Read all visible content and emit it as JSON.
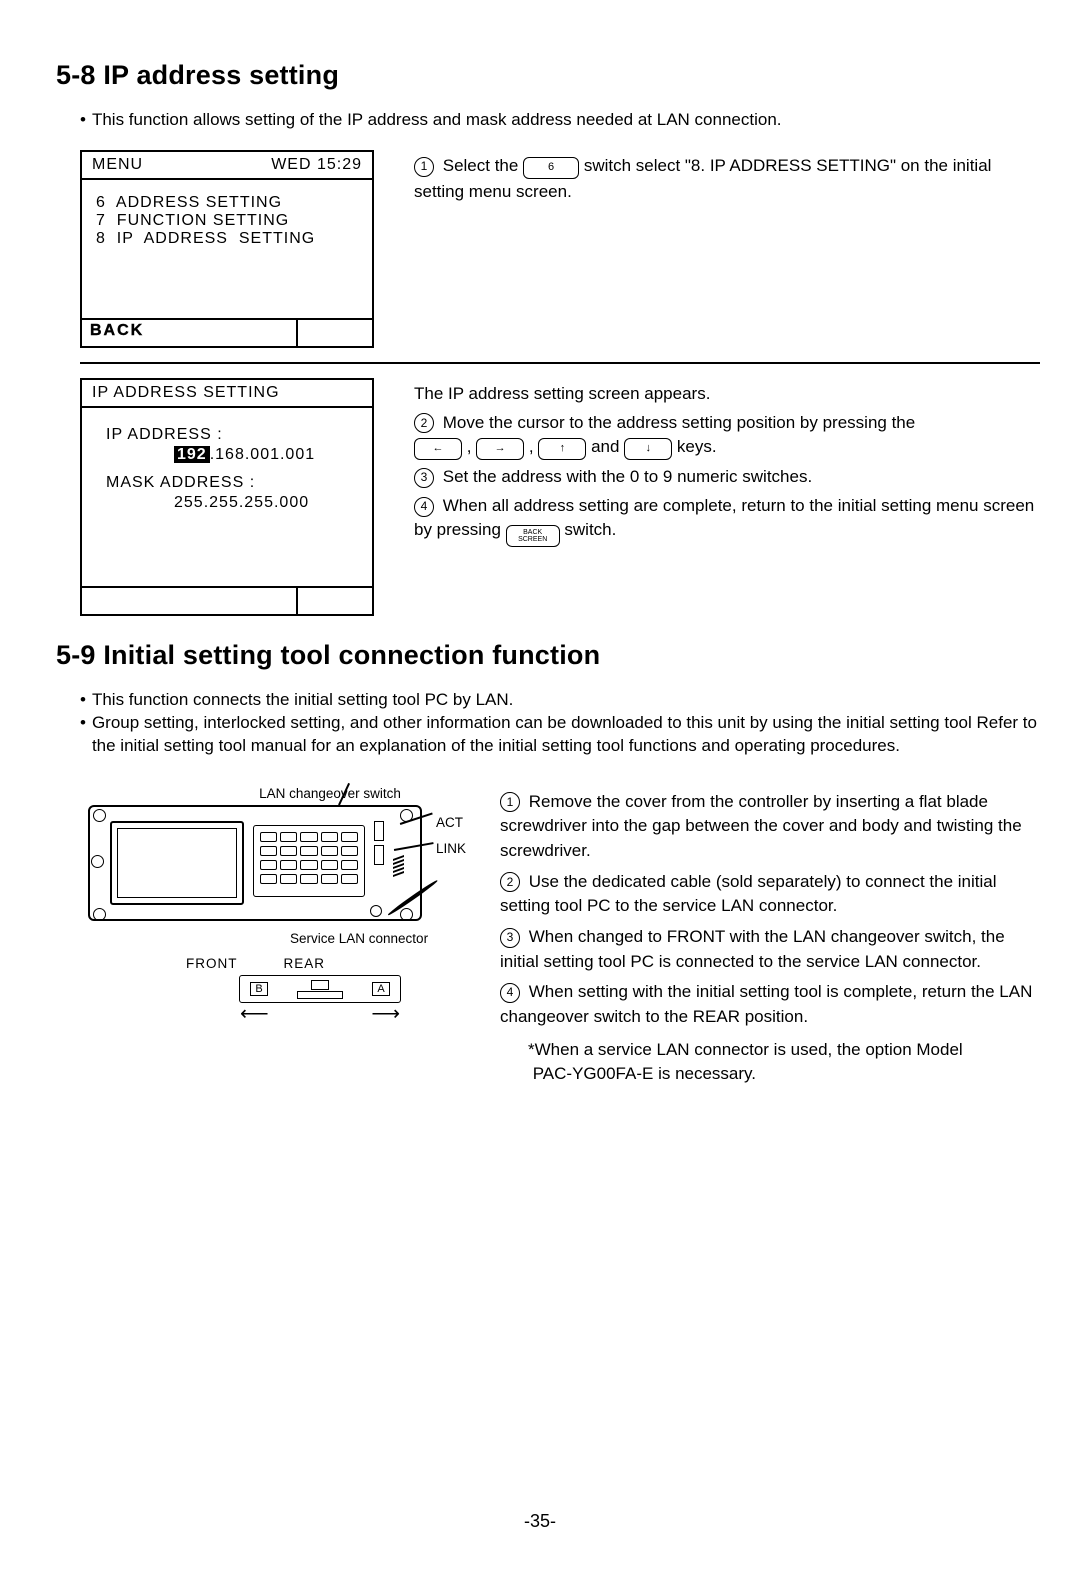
{
  "section58": {
    "title": "5-8 IP address setting",
    "bullet": "This function allows setting of the IP address and mask address needed at LAN connection.",
    "screen1": {
      "menu_label": "MENU",
      "clock": "WED 15:29",
      "items": [
        "6  ADDRESS SETTING",
        "7  FUNCTION SETTING",
        "8  IP  ADDRESS  SETTING"
      ],
      "back": "BACK"
    },
    "step1": {
      "num": "1",
      "text_a": "Select the",
      "key": "6",
      "text_b": "switch select \"8. IP ADDRESS SETTING\" on the initial setting menu screen."
    },
    "screen2": {
      "title": "IP ADDRESS SETTING",
      "ip_label": "IP ADDRESS :",
      "ip_hi": "192",
      "ip_rest": ".168.001.001",
      "mask_label": "MASK ADDRESS :",
      "mask_val": "255.255.255.000"
    },
    "intro2": "The IP address setting screen appears.",
    "step2": {
      "num": "2",
      "text_a": "Move the cursor to the address setting position by pressing the",
      "keys": [
        "←",
        "→",
        "↑",
        "↓"
      ],
      "and": "and",
      "text_b": "keys."
    },
    "step3": {
      "num": "3",
      "text": "Set the address with the 0 to 9 numeric switches."
    },
    "step4": {
      "num": "4",
      "text_a": "When all address setting are complete, return to the initial setting menu screen by pressing",
      "key": "BACK SCREEN",
      "text_b": "switch."
    }
  },
  "section59": {
    "title": "5-9 Initial setting tool connection function",
    "bullets": [
      "This function connects the initial setting tool PC by LAN.",
      "Group setting, interlocked setting, and other information can be downloaded to this unit by using the initial setting tool Refer to the initial setting tool manual for an explanation of the initial setting tool functions and operating procedures."
    ],
    "diagram": {
      "lan_switch": "LAN changeover switch",
      "act": "ACT",
      "link": "LINK",
      "svc": "Service LAN connector",
      "front": "FRONT",
      "rear": "REAR",
      "b": "B",
      "a": "A"
    },
    "steps": [
      {
        "num": "1",
        "text": "Remove the cover from the controller by inserting a flat blade screwdriver into the gap between the cover and body and twisting the screwdriver."
      },
      {
        "num": "2",
        "text": "Use the dedicated cable (sold separately) to connect the initial setting tool PC to the service LAN connector."
      },
      {
        "num": "3",
        "text": "When changed to FRONT with the LAN changeover switch, the initial setting tool PC is connected to the service LAN connector."
      },
      {
        "num": "4",
        "text": "When setting with the initial setting tool is complete, return the LAN changeover switch to the REAR position."
      }
    ],
    "note_a": "*When a service LAN connector is used, the option Model",
    "note_b": "PAC-YG00FA-E is necessary."
  },
  "page_number": "-35-"
}
